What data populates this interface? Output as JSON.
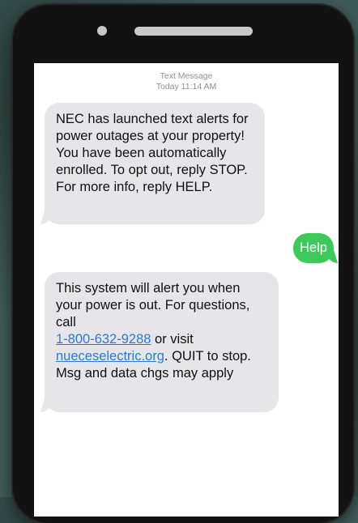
{
  "header": {
    "label": "Text Message",
    "timestamp": "Today 11:14 AM"
  },
  "messages": [
    {
      "direction": "incoming",
      "text": "NEC has launched text alerts for power outages at your property! You have been automatically enrolled. To opt out, reply STOP. For more info, reply HELP."
    },
    {
      "direction": "outgoing",
      "text": "Help"
    },
    {
      "direction": "incoming",
      "part1": "This system will alert you when your power is out. For questions, call",
      "phone_link": "1-800-632-9288",
      "part2": " or visit",
      "web_link": "nueceselectric.org",
      "part3": ".  QUIT to stop. Msg and data chgs may apply"
    }
  ],
  "colors": {
    "incoming_bubble": "#e5e5ea",
    "outgoing_bubble": "#3dca5a",
    "link": "#2a7bd6",
    "phone_frame": "#121212",
    "background": "#3f5b58"
  },
  "icons": {
    "camera": "camera-dot-icon",
    "speaker": "speaker-grille-icon"
  }
}
